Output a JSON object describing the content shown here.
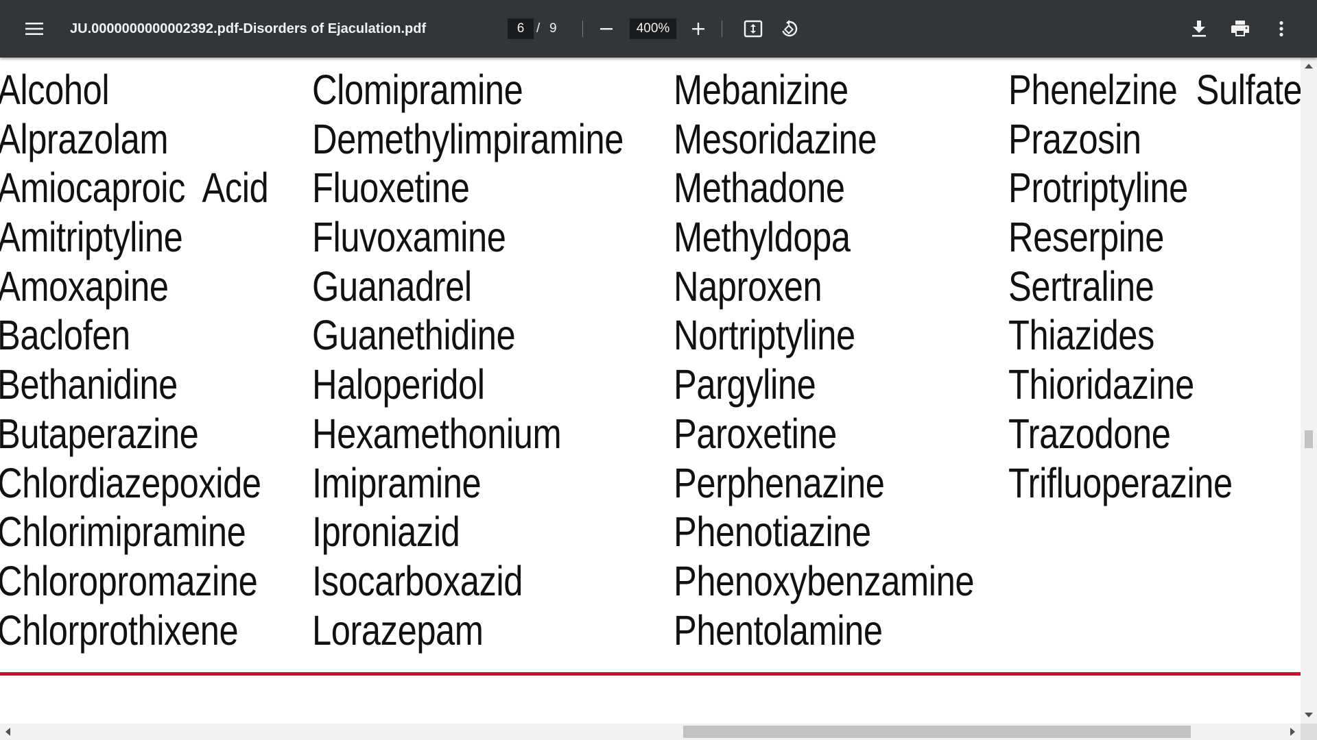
{
  "toolbar": {
    "menu_icon": "hamburger-menu-icon",
    "title": "JU.0000000000002392.pdf-Disorders of Ejaculation.pdf",
    "current_page": "6",
    "page_separator": "/",
    "total_pages": "9",
    "zoom": "400%",
    "icons": {
      "zoom_out": "minus-icon",
      "zoom_in": "plus-icon",
      "fit": "fit-to-page-icon",
      "rotate": "rotate-counterclockwise-icon",
      "download": "download-icon",
      "print": "print-icon",
      "more": "more-vertical-icon"
    },
    "colors": {
      "background": "#323639",
      "text": "#f1f1f1"
    }
  },
  "document": {
    "columns": [
      [
        "Alcohol",
        "Alprazolam",
        "Amiocaproic  Acid",
        "Amitriptyline",
        "Amoxapine",
        "Baclofen",
        "Bethanidine",
        "Butaperazine",
        "Chlordiazepoxide",
        "Chlorimipramine",
        "Chloropromazine",
        "Chlorprothixene"
      ],
      [
        "Clomipramine",
        "Demethylimpiramine",
        "Fluoxetine",
        "Fluvoxamine",
        "Guanadrel",
        "Guanethidine",
        "Haloperidol",
        "Hexamethonium",
        "Imipramine",
        "Iproniazid",
        "Isocarboxazid",
        "Lorazepam"
      ],
      [
        "Mebanizine",
        "Mesoridazine",
        "Methadone",
        "Methyldopa",
        "Naproxen",
        "Nortriptyline",
        "Pargyline",
        "Paroxetine",
        "Perphenazine",
        "Phenotiazine",
        "Phenoxybenzamine",
        "Phentolamine"
      ],
      [
        "Phenelzine  Sulfate",
        "Prazosin",
        "Protriptyline",
        "Reserpine",
        "Sertraline",
        "Thiazides",
        "Thioridazine",
        "Trazodone",
        "Trifluoperazine"
      ]
    ],
    "rule_color": "#c8102e"
  }
}
